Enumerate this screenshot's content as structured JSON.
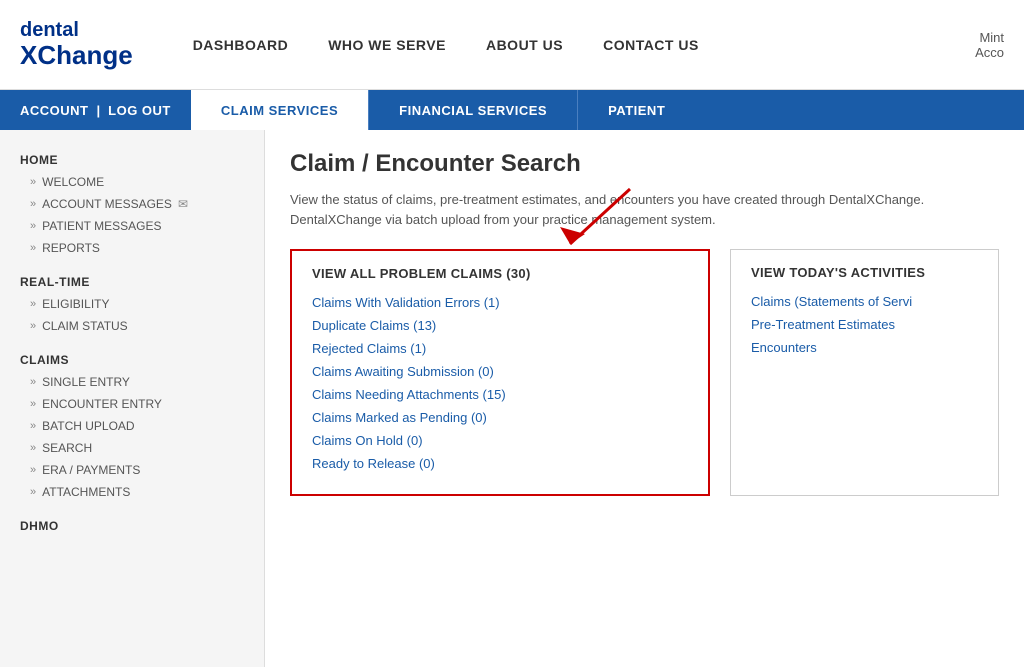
{
  "header": {
    "logo_line1": "dental",
    "logo_line2": "XChange",
    "nav_links": [
      {
        "label": "DASHBOARD",
        "id": "dashboard"
      },
      {
        "label": "WHO WE SERVE",
        "id": "who-we-serve"
      },
      {
        "label": "ABOUT US",
        "id": "about-us"
      },
      {
        "label": "CONTACT US",
        "id": "contact-us"
      }
    ],
    "top_right": "Mint\nAcco"
  },
  "nav_bar": {
    "account_label": "ACCOUNT",
    "logout_label": "LOG OUT",
    "divider": "|",
    "tabs": [
      {
        "label": "CLAIM SERVICES",
        "id": "claim-services",
        "active": true
      },
      {
        "label": "FINANCIAL SERVICES",
        "id": "financial-services",
        "active": false
      },
      {
        "label": "PATIENT",
        "id": "patient",
        "active": false
      }
    ]
  },
  "sidebar": {
    "sections": [
      {
        "title": "HOME",
        "items": [
          {
            "label": "WELCOME",
            "id": "welcome",
            "has_arrow": true
          },
          {
            "label": "ACCOUNT MESSAGES",
            "id": "account-messages",
            "has_arrow": true,
            "has_envelope": true
          },
          {
            "label": "PATIENT MESSAGES",
            "id": "patient-messages",
            "has_arrow": true
          },
          {
            "label": "REPORTS",
            "id": "reports",
            "has_arrow": true
          }
        ]
      },
      {
        "title": "REAL-TIME",
        "items": [
          {
            "label": "ELIGIBILITY",
            "id": "eligibility",
            "has_arrow": true
          },
          {
            "label": "CLAIM STATUS",
            "id": "claim-status",
            "has_arrow": true
          }
        ]
      },
      {
        "title": "CLAIMS",
        "items": [
          {
            "label": "SINGLE ENTRY",
            "id": "single-entry",
            "has_arrow": true
          },
          {
            "label": "ENCOUNTER ENTRY",
            "id": "encounter-entry",
            "has_arrow": true
          },
          {
            "label": "BATCH UPLOAD",
            "id": "batch-upload",
            "has_arrow": true
          },
          {
            "label": "SEARCH",
            "id": "search",
            "has_arrow": true
          },
          {
            "label": "ERA / PAYMENTS",
            "id": "era-payments",
            "has_arrow": true
          },
          {
            "label": "ATTACHMENTS",
            "id": "attachments",
            "has_arrow": true
          }
        ]
      },
      {
        "title": "DHMO",
        "items": []
      }
    ]
  },
  "content": {
    "title": "Claim / Encounter Search",
    "description": "View the status of claims, pre-treatment estimates, and encounters you have created through DentalXChange. DentalXChange via batch upload from your practice management system.",
    "problem_claims": {
      "section_title": "VIEW ALL PROBLEM CLAIMS (30)",
      "links": [
        {
          "label": "Claims With Validation Errors (1)",
          "id": "validation-errors"
        },
        {
          "label": "Duplicate Claims (13)",
          "id": "duplicate-claims"
        },
        {
          "label": "Rejected Claims (1)",
          "id": "rejected-claims"
        },
        {
          "label": "Claims Awaiting Submission (0)",
          "id": "awaiting-submission"
        },
        {
          "label": "Claims Needing Attachments (15)",
          "id": "needing-attachments"
        },
        {
          "label": "Claims Marked as Pending (0)",
          "id": "marked-pending"
        },
        {
          "label": "Claims On Hold (0)",
          "id": "claims-on-hold"
        },
        {
          "label": "Ready to Release (0)",
          "id": "ready-to-release"
        }
      ]
    },
    "today_activities": {
      "section_title": "VIEW TODAY'S ACTIVITIES",
      "links": [
        {
          "label": "Claims (Statements of Servi",
          "id": "claims-today"
        },
        {
          "label": "Pre-Treatment Estimates",
          "id": "pre-treatment"
        },
        {
          "label": "Encounters",
          "id": "encounters"
        }
      ]
    }
  }
}
